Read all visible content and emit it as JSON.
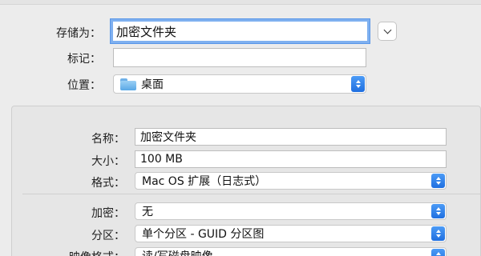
{
  "save_as": {
    "label": "存储为：",
    "value": "加密文件夹"
  },
  "tags": {
    "label": "标记：",
    "value": ""
  },
  "location": {
    "label": "位置：",
    "value": "桌面",
    "icon": "folder-icon"
  },
  "expand_button": {
    "icon": "chevron-down-icon"
  },
  "volume": {
    "name": {
      "label": "名称：",
      "value": "加密文件夹"
    },
    "size": {
      "label": "大小：",
      "value": "100 MB"
    },
    "format": {
      "label": "格式：",
      "value": "Mac OS 扩展（日志式）"
    },
    "encryption": {
      "label": "加密：",
      "value": "无"
    },
    "partitions": {
      "label": "分区：",
      "value": "单个分区 - GUID 分区图"
    },
    "image_format": {
      "label": "映像格式：",
      "value": "读/写磁盘映像"
    }
  },
  "colors": {
    "accent": "#2a7ae8",
    "focus_ring": "#7fb0f0",
    "panel_bg": "#e6e6e6"
  }
}
